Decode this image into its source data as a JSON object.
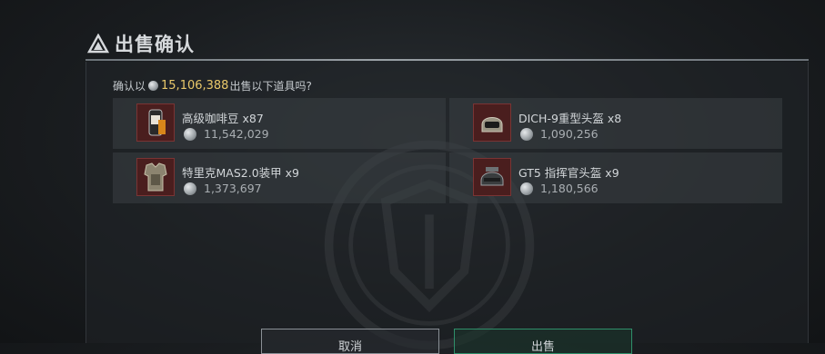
{
  "dialog": {
    "title": "出售确认",
    "prompt_prefix": "确认以",
    "total_amount": "15,106,388",
    "prompt_suffix": "出售以下道具吗?"
  },
  "items": [
    {
      "name": "高级咖啡豆",
      "qty": "x87",
      "price": "11,542,029",
      "icon": "coffee-beans-icon"
    },
    {
      "name": "DICH-9重型头盔",
      "qty": "x8",
      "price": "1,090,256",
      "icon": "heavy-helmet-icon"
    },
    {
      "name": "特里克MAS2.0装甲",
      "qty": "x9",
      "price": "1,373,697",
      "icon": "body-armor-icon"
    },
    {
      "name": "GT5 指挥官头盔",
      "qty": "x9",
      "price": "1,180,566",
      "icon": "commander-helmet-icon"
    }
  ],
  "buttons": {
    "cancel_label": "取消",
    "confirm_label": "出售"
  },
  "colors": {
    "amount": "#e9c86a",
    "thumb_bg": "#4a1e1e",
    "confirm_border": "#2f8f6a"
  }
}
